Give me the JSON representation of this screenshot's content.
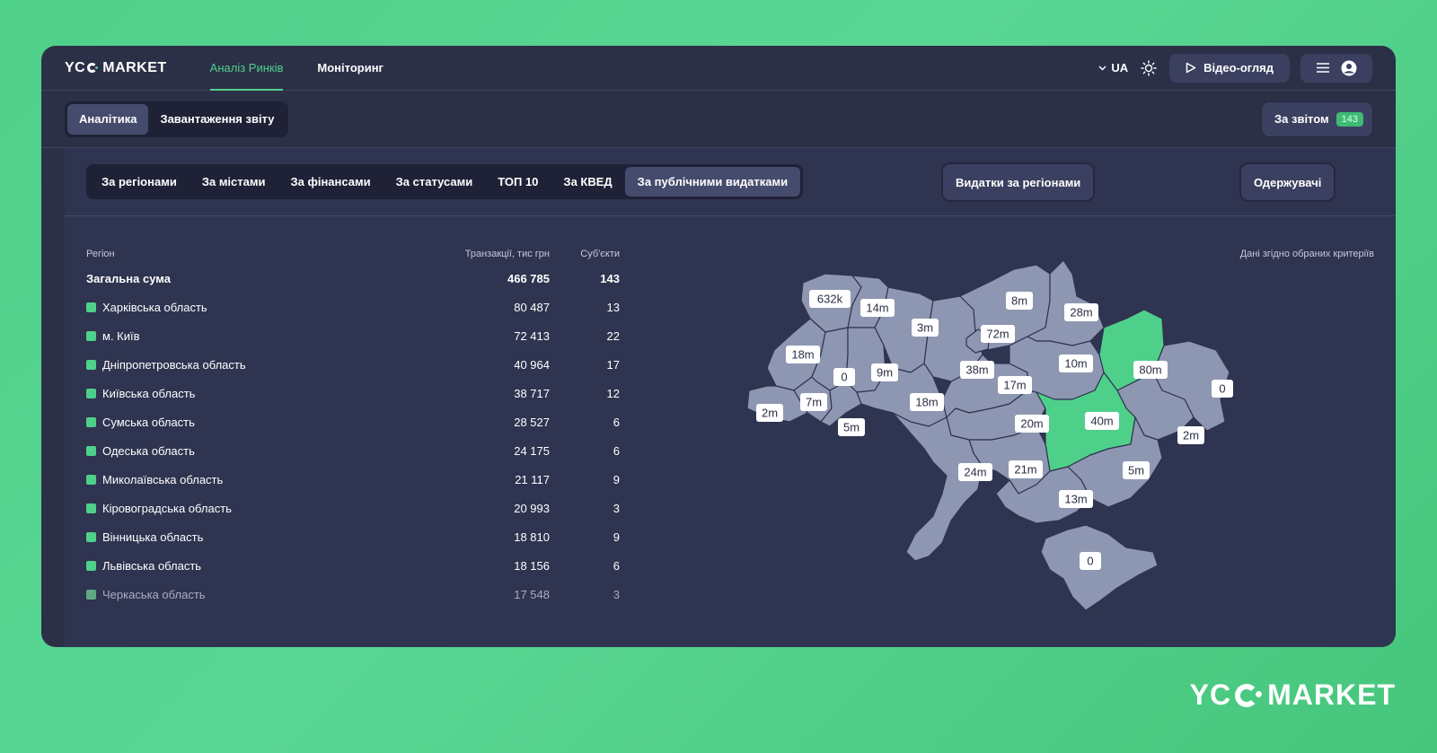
{
  "brand": {
    "name_left": "YC",
    "name_right": "MARKET"
  },
  "nav": {
    "items": [
      {
        "label": "Аналіз Ринків",
        "active": true
      },
      {
        "label": "Моніторинг",
        "active": false
      }
    ]
  },
  "top_right": {
    "lang": "UA",
    "video_label": "Відео-огляд"
  },
  "subnav": {
    "items": [
      {
        "label": "Аналітика",
        "active": true
      },
      {
        "label": "Завантаження звіту",
        "active": false
      }
    ],
    "report_label": "За звітом",
    "report_count": "143"
  },
  "tabs": {
    "items": [
      {
        "label": "За регіонами",
        "active": false
      },
      {
        "label": "За містами",
        "active": false
      },
      {
        "label": "За фінансами",
        "active": false
      },
      {
        "label": "За статусами",
        "active": false
      },
      {
        "label": "ТОП 10",
        "active": false
      },
      {
        "label": "За КВЕД",
        "active": false
      },
      {
        "label": "За публічними видатками",
        "active": true
      }
    ],
    "regions_btn": "Видатки за регіонами",
    "recipients_btn": "Одержувачі"
  },
  "table": {
    "headers": {
      "region": "Регіон",
      "amount": "Транзакції, тис грн",
      "count": "Суб'єкти"
    },
    "total": {
      "label": "Загальна сума",
      "amount": "466 785",
      "count": "143"
    },
    "rows": [
      {
        "region": "Харківська область",
        "amount": "80 487",
        "count": "13"
      },
      {
        "region": "м. Київ",
        "amount": "72 413",
        "count": "22"
      },
      {
        "region": "Дніпропетровська область",
        "amount": "40 964",
        "count": "17"
      },
      {
        "region": "Київська область",
        "amount": "38 717",
        "count": "12"
      },
      {
        "region": "Сумська область",
        "amount": "28 527",
        "count": "6"
      },
      {
        "region": "Одеська область",
        "amount": "24 175",
        "count": "6"
      },
      {
        "region": "Миколаївська область",
        "amount": "21 117",
        "count": "9"
      },
      {
        "region": "Кіровоградська область",
        "amount": "20 993",
        "count": "3"
      },
      {
        "region": "Вінницька область",
        "amount": "18 810",
        "count": "9"
      },
      {
        "region": "Львівська область",
        "amount": "18 156",
        "count": "6"
      },
      {
        "region": "Черкаська область",
        "amount": "17 548",
        "count": "3"
      }
    ]
  },
  "map": {
    "note": "Дані згідно обраних критеріїв",
    "colors": {
      "default": "#8e97b2",
      "highlight": "#4fd08a"
    },
    "labels": [
      "632k",
      "14m",
      "3m",
      "8m",
      "28m",
      "72m",
      "18m",
      "0",
      "9m",
      "38m",
      "10m",
      "80m",
      "0",
      "17m",
      "7m",
      "2m",
      "5m",
      "18m",
      "20m",
      "40m",
      "2m",
      "24m",
      "21m",
      "5m",
      "13m",
      "0"
    ]
  },
  "footer_brand": {
    "name_left": "YC",
    "name_right": "MARKET"
  }
}
